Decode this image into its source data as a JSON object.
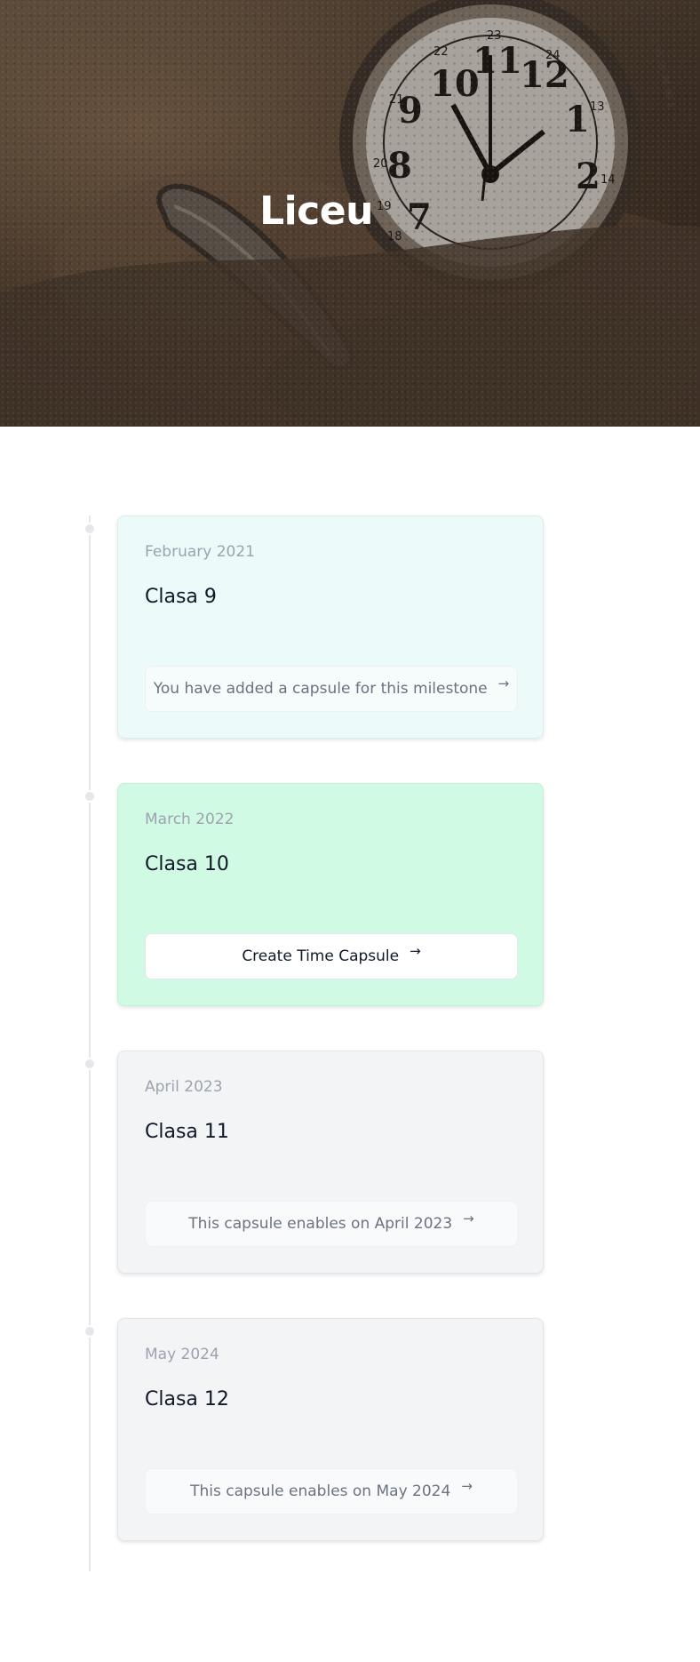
{
  "hero": {
    "title": "Liceu",
    "image_description": "pocket watch in sand",
    "clock_numerals": [
      "10",
      "11",
      "12",
      "1",
      "2",
      "9",
      "8",
      "7",
      "22",
      "23",
      "24",
      "21",
      "20",
      "13",
      "14",
      "19",
      "18"
    ]
  },
  "milestones": [
    {
      "date": "February 2021",
      "title": "Clasa 9",
      "state": "added",
      "action_label": "You have added a capsule for this milestone",
      "arrow": "→"
    },
    {
      "date": "March 2022",
      "title": "Clasa 10",
      "state": "active",
      "action_label": "Create Time Capsule",
      "arrow": "→"
    },
    {
      "date": "April 2023",
      "title": "Clasa 11",
      "state": "locked",
      "action_label": "This capsule enables on April 2023",
      "arrow": "→"
    },
    {
      "date": "May 2024",
      "title": "Clasa 12",
      "state": "locked",
      "action_label": "This capsule enables on May 2024",
      "arrow": "→"
    }
  ],
  "colors": {
    "added_card": "#edfafa",
    "active_card": "#d1fae5",
    "locked_card": "#f3f4f6",
    "timeline_line": "#e5e7eb"
  }
}
